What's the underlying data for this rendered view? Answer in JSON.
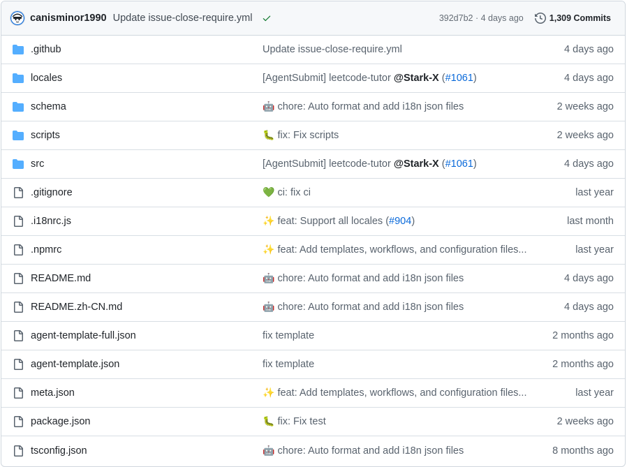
{
  "latest_commit": {
    "author": "canisminor1990",
    "message": "Update issue-close-require.yml",
    "status": "success",
    "sha": "392d7b2",
    "separator": " · ",
    "time": "4 days ago",
    "commits_count": "1,309 Commits"
  },
  "files": [
    {
      "name": ".github",
      "type": "dir",
      "emoji": "",
      "msg": "Update issue-close-require.yml",
      "mention": "",
      "issue": "",
      "time": "4 days ago"
    },
    {
      "name": "locales",
      "type": "dir",
      "emoji": "",
      "msg": "[AgentSubmit] leetcode-tutor ",
      "mention": "@Stark-X",
      "issue": "#1061",
      "time": "4 days ago"
    },
    {
      "name": "schema",
      "type": "dir",
      "emoji": "🤖",
      "msg": "chore: Auto format and add i18n json files",
      "mention": "",
      "issue": "",
      "time": "2 weeks ago"
    },
    {
      "name": "scripts",
      "type": "dir",
      "emoji": "🐛",
      "msg": "fix: Fix scripts",
      "mention": "",
      "issue": "",
      "time": "2 weeks ago"
    },
    {
      "name": "src",
      "type": "dir",
      "emoji": "",
      "msg": "[AgentSubmit] leetcode-tutor ",
      "mention": "@Stark-X",
      "issue": "#1061",
      "time": "4 days ago"
    },
    {
      "name": ".gitignore",
      "type": "file",
      "emoji": "💚",
      "msg": "ci: fix ci",
      "mention": "",
      "issue": "",
      "time": "last year"
    },
    {
      "name": ".i18nrc.js",
      "type": "file",
      "emoji": "✨",
      "msg": "feat: Support all locales ",
      "mention": "",
      "issue": "#904",
      "time": "last month"
    },
    {
      "name": ".npmrc",
      "type": "file",
      "emoji": "✨",
      "msg": "feat: Add templates, workflows, and configuration files...",
      "mention": "",
      "issue": "",
      "time": "last year"
    },
    {
      "name": "README.md",
      "type": "file",
      "emoji": "🤖",
      "msg": "chore: Auto format and add i18n json files",
      "mention": "",
      "issue": "",
      "time": "4 days ago"
    },
    {
      "name": "README.zh-CN.md",
      "type": "file",
      "emoji": "🤖",
      "msg": "chore: Auto format and add i18n json files",
      "mention": "",
      "issue": "",
      "time": "4 days ago"
    },
    {
      "name": "agent-template-full.json",
      "type": "file",
      "emoji": "",
      "msg": "fix template",
      "mention": "",
      "issue": "",
      "time": "2 months ago"
    },
    {
      "name": "agent-template.json",
      "type": "file",
      "emoji": "",
      "msg": "fix template",
      "mention": "",
      "issue": "",
      "time": "2 months ago"
    },
    {
      "name": "meta.json",
      "type": "file",
      "emoji": "✨",
      "msg": "feat: Add templates, workflows, and configuration files...",
      "mention": "",
      "issue": "",
      "time": "last year"
    },
    {
      "name": "package.json",
      "type": "file",
      "emoji": "🐛",
      "msg": "fix: Fix test",
      "mention": "",
      "issue": "",
      "time": "2 weeks ago"
    },
    {
      "name": "tsconfig.json",
      "type": "file",
      "emoji": "🤖",
      "msg": "chore: Auto format and add i18n json files",
      "mention": "",
      "issue": "",
      "time": "8 months ago"
    }
  ],
  "colors": {
    "folder": "#54aeff",
    "file_icon": "#59636e",
    "link": "#0969da",
    "success": "#1a7f37"
  }
}
